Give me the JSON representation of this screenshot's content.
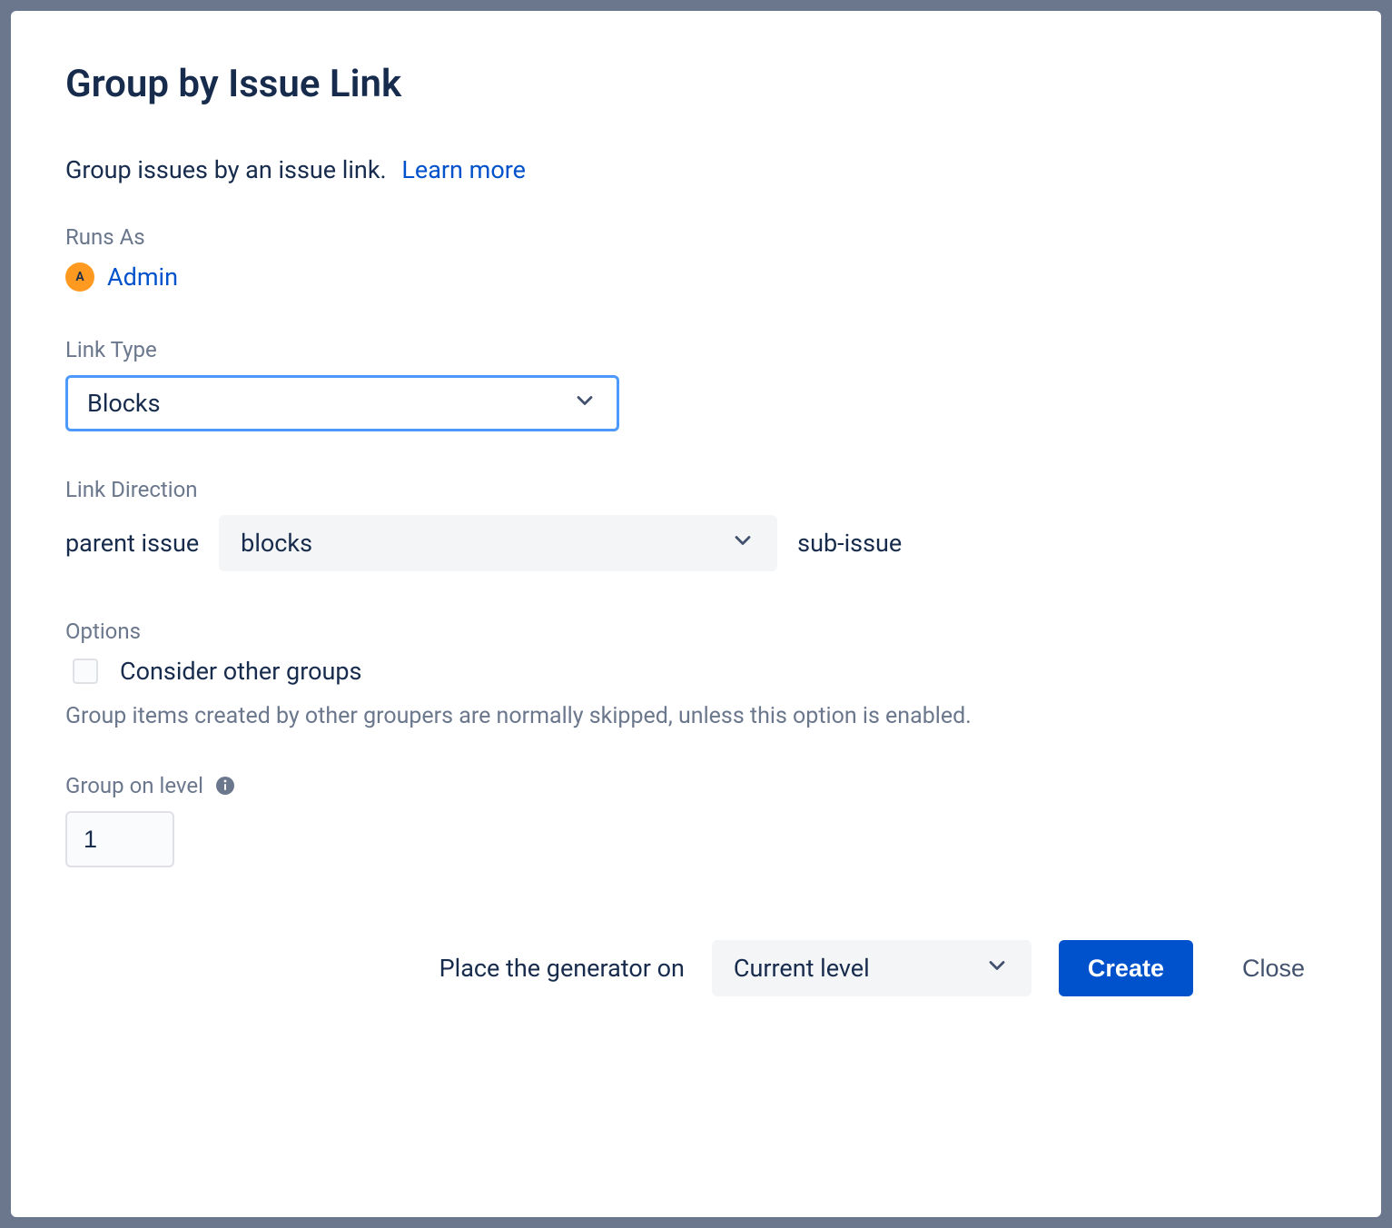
{
  "dialog": {
    "title": "Group by Issue Link",
    "subtitle": "Group issues by an issue link.",
    "learn_more_label": "Learn more"
  },
  "runs_as": {
    "label": "Runs As",
    "avatar_initial": "A",
    "user_name": "Admin"
  },
  "link_type": {
    "label": "Link Type",
    "value": "Blocks"
  },
  "link_direction": {
    "label": "Link Direction",
    "left_text": "parent issue",
    "value": "blocks",
    "right_text": "sub-issue"
  },
  "options": {
    "label": "Options",
    "checkbox_label": "Consider other groups",
    "checkbox_checked": false,
    "help_text": "Group items created by other groupers are normally skipped, unless this option is enabled."
  },
  "group_level": {
    "label": "Group on level",
    "value": "1"
  },
  "footer": {
    "placement_label": "Place the generator on",
    "placement_value": "Current level",
    "create_label": "Create",
    "close_label": "Close"
  }
}
